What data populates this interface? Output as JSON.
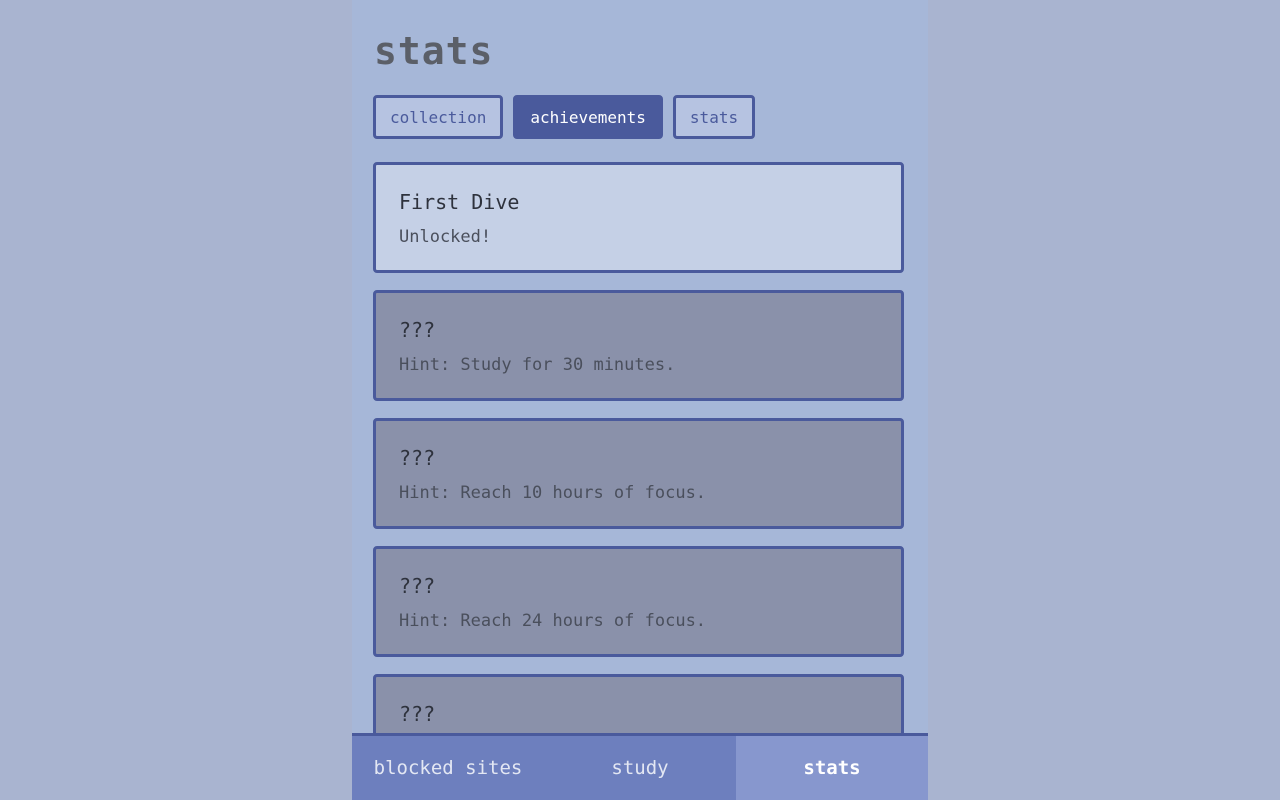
{
  "page": {
    "title": "stats"
  },
  "tabs": [
    {
      "label": "collection",
      "active": false
    },
    {
      "label": "achievements",
      "active": true
    },
    {
      "label": "stats",
      "active": false
    }
  ],
  "achievements": [
    {
      "title": "First Dive",
      "description": "Unlocked!",
      "unlocked": true
    },
    {
      "title": "???",
      "description": "Hint: Study for 30 minutes.",
      "unlocked": false
    },
    {
      "title": "???",
      "description": "Hint: Reach 10 hours of focus.",
      "unlocked": false
    },
    {
      "title": "???",
      "description": "Hint: Reach 24 hours of focus.",
      "unlocked": false
    },
    {
      "title": "???",
      "description": "",
      "unlocked": false
    }
  ],
  "bottom_nav": [
    {
      "label": "blocked sites",
      "active": false
    },
    {
      "label": "study",
      "active": false
    },
    {
      "label": "stats",
      "active": true
    }
  ],
  "colors": {
    "page_background": "#a9b4d0",
    "panel_background": "#a6b7d8",
    "accent": "#4a5a9c",
    "unlocked_card": "#c5d0e6",
    "locked_card": "#8a91aa",
    "nav_background": "#6d7fbe",
    "nav_active": "#8797ce"
  }
}
